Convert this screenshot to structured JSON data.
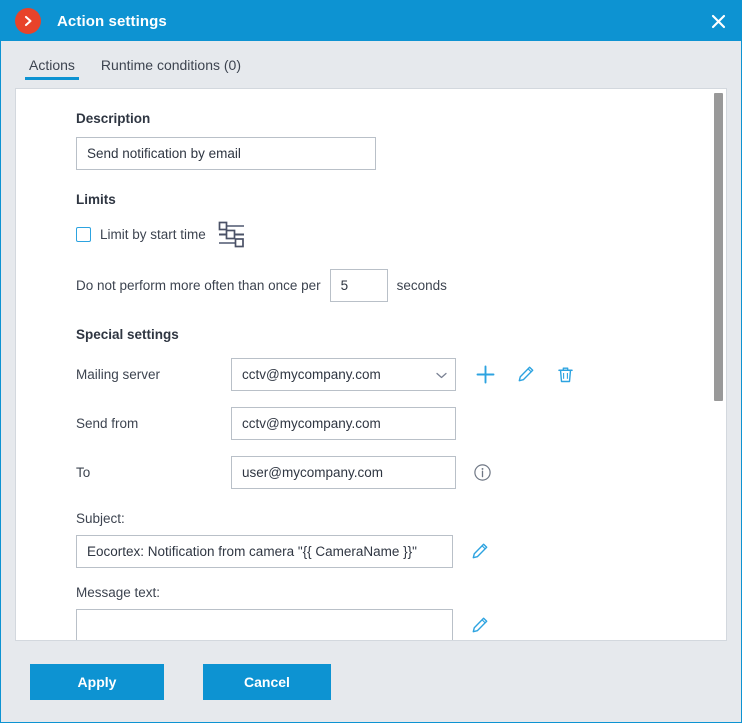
{
  "titlebar": {
    "app_icon": "chevron-right-circle-icon",
    "title": "Action settings",
    "close_icon": "close-icon",
    "bg_color": "#0d93d2",
    "badge_color": "#e8432a"
  },
  "tabs": [
    {
      "label": "Actions",
      "active": true
    },
    {
      "label": "Runtime conditions (0)",
      "active": false
    }
  ],
  "form": {
    "description": {
      "section_title": "Description",
      "value": "Send notification by email",
      "placeholder": "Description"
    },
    "limits": {
      "section_title": "Limits",
      "limit_by_start_time_label": "Limit by start time",
      "limit_by_start_time_checked": false,
      "sliders_icon": "sliders-icon",
      "interval_prefix": "Do not perform more often than once per",
      "interval_value": "5",
      "interval_suffix": "seconds"
    },
    "special_settings": {
      "section_title": "Special settings",
      "mailing_server_label": "Mailing server",
      "mailing_server_value": "cctv@mycompany.com",
      "add_icon": "plus-icon",
      "edit_icon": "pencil-icon",
      "delete_icon": "trash-icon",
      "send_from_label": "Send from",
      "send_from_value": "cctv@mycompany.com",
      "to_label": "To",
      "to_value": "user@mycompany.com",
      "info_icon": "info-icon",
      "subject_label": "Subject:",
      "subject_value": "Eocortex: Notification from camera \"{{ CameraName }}\"",
      "subject_edit_icon": "pencil-icon",
      "message_text_label": "Message text:",
      "message_text_value": "",
      "message_text_placeholder": ""
    }
  },
  "scrollbar": {
    "name": "vertical-scrollbar",
    "thumb_color": "#999999"
  },
  "footer": {
    "apply_label": "Apply",
    "cancel_label": "Cancel",
    "button_color": "#0d93d2"
  }
}
